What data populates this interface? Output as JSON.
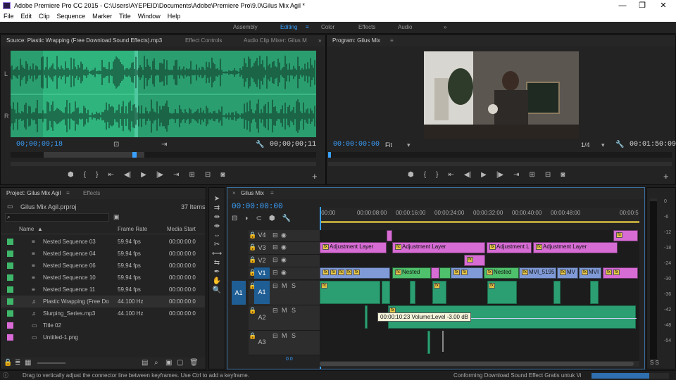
{
  "window": {
    "title": "Adobe Premiere Pro CC 2015 - C:\\Users\\AYEPEID\\Documents\\Adobe\\Premiere Pro\\9.0\\Gilus Mix Agil *"
  },
  "menu": [
    "File",
    "Edit",
    "Clip",
    "Sequence",
    "Marker",
    "Title",
    "Window",
    "Help"
  ],
  "workspaces": [
    "Assembly",
    "Editing",
    "Color",
    "Effects",
    "Audio"
  ],
  "source_panel": {
    "tabs": [
      "Source: Plastic Wrapping (Free Download Sound Effects).mp3",
      "Effect Controls",
      "Audio Clip Mixer: Gilus M"
    ],
    "channel_l": "L",
    "channel_r": "R",
    "timecode_current": "00;00;09;18",
    "timecode_duration": "00;00;00;11"
  },
  "program_panel": {
    "title": "Program: Gilus Mix",
    "timecode_current": "00:00:00:00",
    "fit": "Fit",
    "resolution": "1/4",
    "timecode_duration": "00:01:50:09"
  },
  "project_panel": {
    "tabs": [
      "Project: Gilus Mix Agil",
      "Effects"
    ],
    "file": "Gilus Mix Agil.prproj",
    "items_count": "37 Items",
    "columns": [
      "Name",
      "Frame Rate",
      "Media Start"
    ],
    "rows": [
      {
        "name": "Nested Sequence 03",
        "rate": "59,94 fps",
        "start": "00:00:00:0",
        "color": "#3fb76a"
      },
      {
        "name": "Nested Sequence 04",
        "rate": "59,94 fps",
        "start": "00:00:00:0",
        "color": "#3fb76a"
      },
      {
        "name": "Nested Sequence 06",
        "rate": "59,94 fps",
        "start": "00:00:00:0",
        "color": "#3fb76a"
      },
      {
        "name": "Nested Sequence 10",
        "rate": "59,94 fps",
        "start": "00:00:00:0",
        "color": "#3fb76a"
      },
      {
        "name": "Nested Sequence 11",
        "rate": "59,94 fps",
        "start": "00:00:00:0",
        "color": "#3fb76a"
      },
      {
        "name": "Plastic Wrapping (Free Do",
        "rate": "44.100 Hz",
        "start": "00:00:00:0",
        "color": "#3fb76a"
      },
      {
        "name": "Slurping_Series.mp3",
        "rate": "44.100 Hz",
        "start": "00:00:00:0",
        "color": "#3fb76a"
      },
      {
        "name": "Title 02",
        "rate": "",
        "start": "",
        "color": "#d96ad6"
      },
      {
        "name": "Untitled-1.png",
        "rate": "",
        "start": "",
        "color": "#d96ad6"
      }
    ]
  },
  "timeline": {
    "tab": "Gilus Mix",
    "timecode": "00:00:00:00",
    "ruler": [
      ":00:00",
      "00:00:08:00",
      "00:00:16:00",
      "00:00:24:00",
      "00:00:32:00",
      "00:00:40:00",
      "00:00:48:00",
      "00:00:5"
    ],
    "tracks": [
      "V4",
      "V3",
      "V2",
      "V1",
      "A1",
      "A2",
      "A3"
    ],
    "src_v": "V1",
    "src_a": "A1",
    "clip_adj1": "Adjustment Layer",
    "clip_adj2": "Adjustment Layer",
    "clip_adj3": "Adjustment L",
    "clip_adj4": "Adjustment Layer",
    "clip_nested1": "Nested",
    "clip_nested2": "Nested",
    "clip_mvi1": "MVI_5195",
    "clip_mvi2": "MV",
    "clip_mvi3": "MVI",
    "tooltip": "00:00:10:23  Volume:Level  -3.00 dB",
    "mix_value": "0.0",
    "ms": "M",
    "ss": "S"
  },
  "meter": {
    "ticks": [
      "0",
      "-6",
      "-12",
      "-18",
      "-24",
      "-30",
      "-36",
      "-42",
      "-48",
      "-54"
    ],
    "solo": "S S"
  },
  "status": {
    "hint": "Drag to vertically adjust the connector line between keyframes. Use Ctrl to add a keyframe.",
    "task": "Conforming Download Sound Effect Gratis untuk Vi"
  }
}
